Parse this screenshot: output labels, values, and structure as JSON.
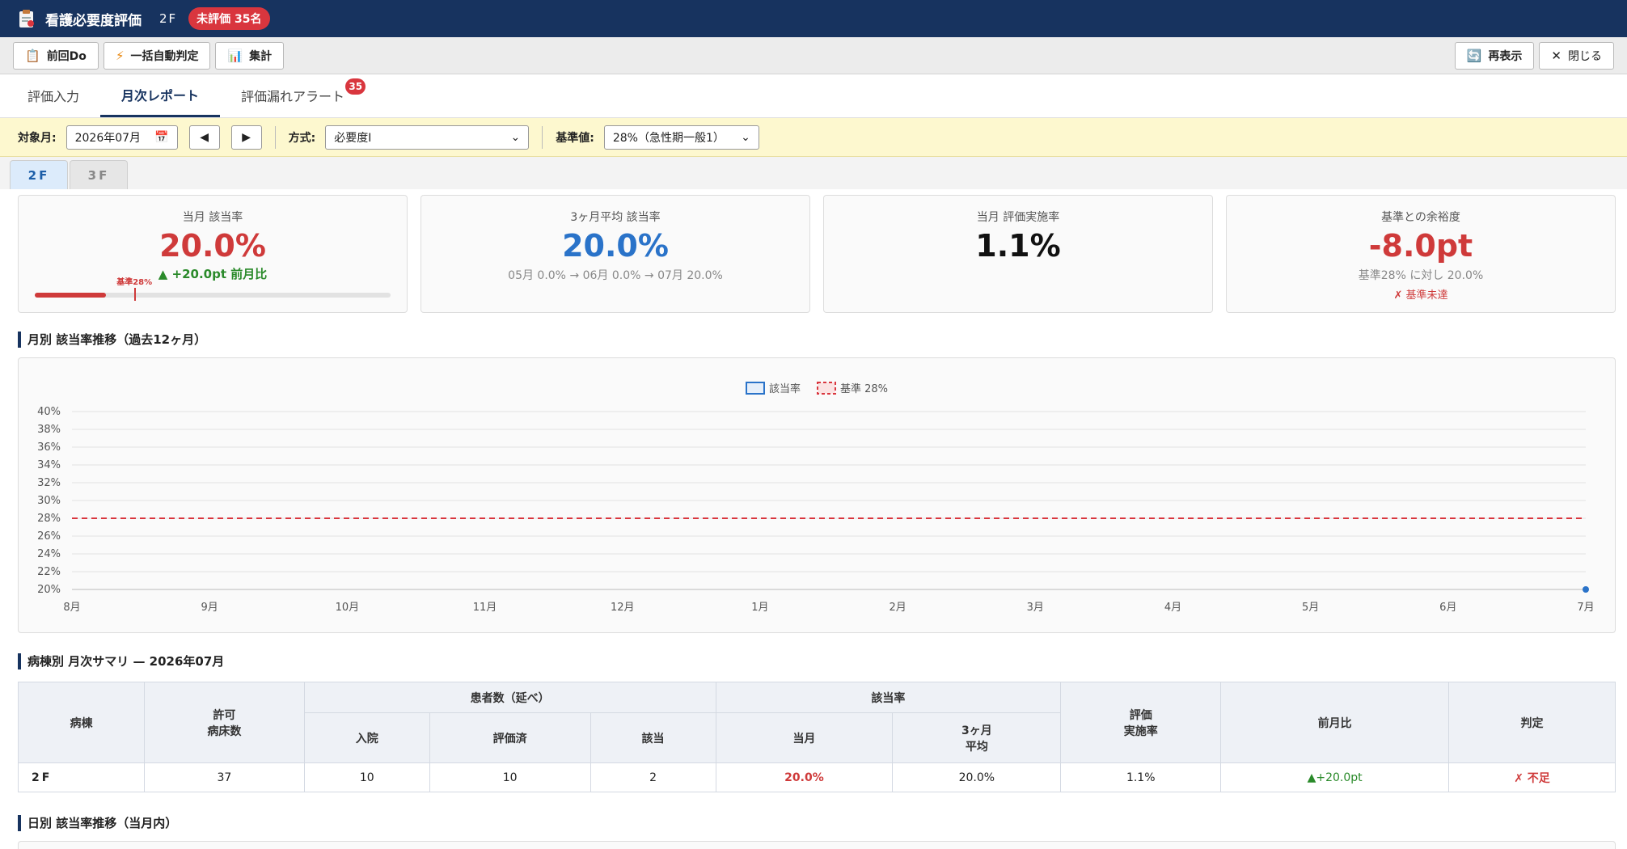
{
  "titlebar": {
    "title": "看護必要度評価",
    "ward": "2F",
    "badge": "未評価 35名"
  },
  "toolbar": {
    "prev_do": "前回Do",
    "auto_judge": "一括自動判定",
    "aggregate": "集計",
    "refresh": "再表示",
    "close": "閉じる"
  },
  "tabs": [
    {
      "label": "評価入力"
    },
    {
      "label": "月次レポート"
    },
    {
      "label": "評価漏れアラート",
      "badge": "35"
    }
  ],
  "filters": {
    "month_label": "対象月:",
    "month_value": "2026年07月",
    "method_label": "方式:",
    "method_value": "必要度Ⅰ",
    "standard_label": "基準値:",
    "standard_value": "28%（急性期一般1）"
  },
  "ward_tabs": [
    "2F",
    "3F"
  ],
  "kpi": {
    "current_rate": {
      "label": "当月 該当率",
      "value": "20.0%",
      "delta": "▲ +20.0pt 前月比",
      "progress_fraction": 0.2,
      "marker_label": "基準28%",
      "marker_fraction": 0.28
    },
    "avg3": {
      "label": "3ヶ月平均 該当率",
      "value": "20.0%",
      "sub": "05月 0.0% → 06月 0.0% → 07月 20.0%"
    },
    "impl": {
      "label": "当月 評価実施率",
      "value": "1.1%"
    },
    "margin": {
      "label": "基準との余裕度",
      "value": "-8.0pt",
      "sub": "基準28% に対し 20.0%",
      "verdict": "✗ 基準未達"
    }
  },
  "section_trend": "月別 該当率推移（過去12ヶ月）",
  "chart_data": {
    "type": "line",
    "categories": [
      "8月",
      "9月",
      "10月",
      "11月",
      "12月",
      "1月",
      "2月",
      "3月",
      "4月",
      "5月",
      "6月",
      "7月"
    ],
    "series": [
      {
        "name": "該当率",
        "values": [
          null,
          null,
          null,
          null,
          null,
          null,
          null,
          null,
          null,
          null,
          null,
          20.0
        ]
      },
      {
        "name": "基準 28%",
        "values": [
          28,
          28,
          28,
          28,
          28,
          28,
          28,
          28,
          28,
          28,
          28,
          28
        ]
      }
    ],
    "y_ticks": [
      "20%",
      "22%",
      "24%",
      "26%",
      "28%",
      "30%",
      "32%",
      "34%",
      "36%",
      "38%",
      "40%"
    ],
    "ylim": [
      20,
      40
    ],
    "legend": "top-center",
    "grid": true,
    "colors": {
      "rate": "#2a73c9",
      "standard": "#d9363e"
    }
  },
  "section_summary": "病棟別 月次サマリ — 2026年07月",
  "table": {
    "headers": {
      "ward": "病棟",
      "beds_1": "許可",
      "beds_2": "病床数",
      "patients": "患者数（延べ）",
      "admit": "入院",
      "evaluated": "評価済",
      "applicable": "該当",
      "rate": "該当率",
      "current": "当月",
      "avg3_1": "3ヶ月",
      "avg3_2": "平均",
      "impl_1": "評価",
      "impl_2": "実施率",
      "mom": "前月比",
      "judge": "判定"
    },
    "rows": [
      {
        "ward": "2F",
        "beds": "37",
        "admit": "10",
        "evaluated": "10",
        "applicable": "2",
        "current": "20.0%",
        "avg3": "20.0%",
        "impl": "1.1%",
        "mom": "▲+20.0pt",
        "judge": "✗ 不足"
      }
    ]
  },
  "section_daily": "日別 該当率推移（当月内）"
}
